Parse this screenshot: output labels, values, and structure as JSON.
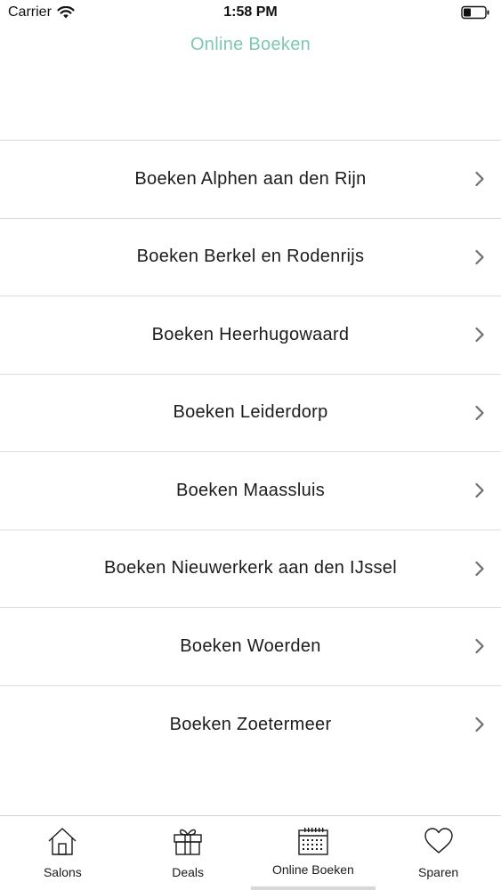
{
  "status_bar": {
    "carrier": "Carrier",
    "time": "1:58 PM"
  },
  "header": {
    "title": "Online Boeken",
    "title_color": "#7cc8b3"
  },
  "list": {
    "items": [
      {
        "label": "Boeken Alphen aan den Rijn"
      },
      {
        "label": "Boeken Berkel en Rodenrijs"
      },
      {
        "label": "Boeken Heerhugowaard"
      },
      {
        "label": "Boeken Leiderdorp"
      },
      {
        "label": "Boeken Maassluis"
      },
      {
        "label": "Boeken Nieuwerkerk aan den IJssel"
      },
      {
        "label": "Boeken Woerden"
      },
      {
        "label": "Boeken Zoetermeer"
      }
    ]
  },
  "tab_bar": {
    "tabs": [
      {
        "label": "Salons",
        "icon": "home-icon"
      },
      {
        "label": "Deals",
        "icon": "gift-icon"
      },
      {
        "label": "Online Boeken",
        "icon": "calendar-icon",
        "active": true
      },
      {
        "label": "Sparen",
        "icon": "heart-icon"
      }
    ]
  }
}
